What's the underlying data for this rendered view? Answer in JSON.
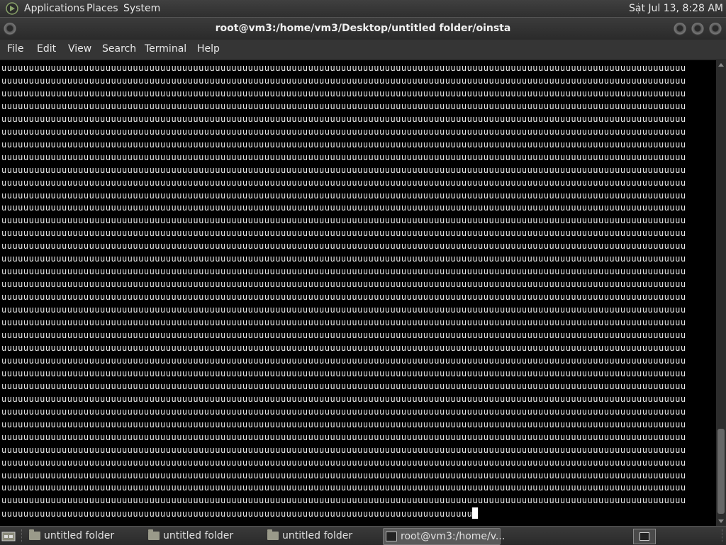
{
  "top_panel": {
    "app_icon": "gnome-foot-icon",
    "menus": [
      "Applications",
      "Places",
      "System"
    ],
    "clock": "Sat Jul 13,  8:28 AM"
  },
  "window": {
    "title": "root@vm3:/home/vm3/Desktop/untitled folder/oinsta",
    "buttons": [
      "minimize-icon",
      "maximize-icon",
      "close-icon"
    ]
  },
  "menubar": [
    "File",
    "Edit",
    "View",
    "Search",
    "Terminal",
    "Help"
  ],
  "terminal": {
    "fill_char": "u",
    "chars_per_line": 125,
    "full_lines": 35,
    "last_line_chars": 86,
    "colors": {
      "background": "#000000",
      "foreground": "#e8e8e8",
      "cursor": "#ffffff"
    }
  },
  "taskbar": {
    "tasks": [
      {
        "label": "untitled folder",
        "icon": "folder-icon"
      },
      {
        "label": "untitled folder",
        "icon": "folder-icon"
      },
      {
        "label": "untitled folder",
        "icon": "folder-icon"
      },
      {
        "label": "root@vm3:/home/v...",
        "icon": "terminal-icon",
        "active": true
      }
    ]
  }
}
